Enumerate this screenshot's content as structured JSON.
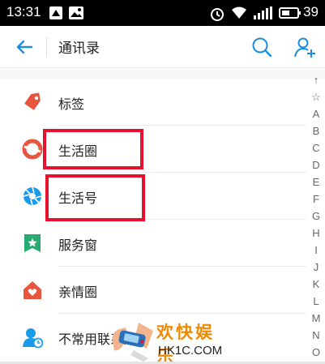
{
  "status_bar": {
    "time": "13:31",
    "battery_percent": "39",
    "icons": [
      "notification-icon",
      "image-icon",
      "alarm-icon",
      "wifi-icon",
      "signal-icon",
      "battery-icon"
    ]
  },
  "header": {
    "title": "通讯录",
    "back_icon": "back-arrow-icon",
    "search_icon": "search-icon",
    "add_contact_icon": "add-user-icon"
  },
  "list": {
    "items": [
      {
        "label": "标签",
        "icon": "tag-icon",
        "color": "#e8553e"
      },
      {
        "label": "生活圈",
        "icon": "life-circle-icon",
        "color": "#e8553e"
      },
      {
        "label": "生活号",
        "icon": "life-account-icon",
        "color": "#1a9be8"
      },
      {
        "label": "服务窗",
        "icon": "service-window-icon",
        "color": "#27ab6f"
      },
      {
        "label": "亲情圈",
        "icon": "family-icon",
        "color": "#e8553e"
      },
      {
        "label": "不常用联系人",
        "icon": "contact-clock-icon",
        "color": "#1a9be8"
      }
    ]
  },
  "index_bar": [
    "↑",
    "☆",
    "A",
    "B",
    "C",
    "D",
    "E",
    "F",
    "G",
    "H",
    "I",
    "J",
    "K",
    "L",
    "M",
    "N",
    "O"
  ],
  "watermark": {
    "cn": "欢快娱乐",
    "en": "HK1C.COM"
  },
  "colors": {
    "accent": "#1a8ee0",
    "highlight": "#e8102d"
  }
}
